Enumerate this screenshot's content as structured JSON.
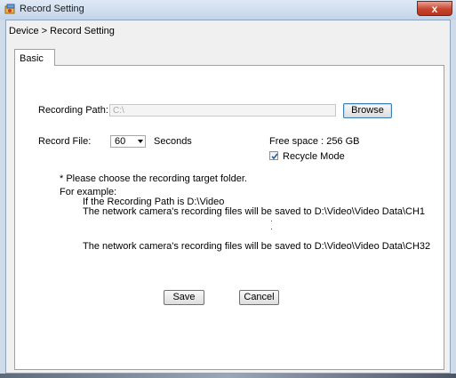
{
  "window": {
    "title": "Record Setting",
    "close_glyph": "x"
  },
  "breadcrumb": "Device > Record Setting",
  "tabs": [
    {
      "label": "Basic"
    }
  ],
  "form": {
    "recording_path_label": "Recording Path:",
    "recording_path_value": "C:\\",
    "browse_label": "Browse",
    "record_file_label": "Record File:",
    "record_file_value": "60",
    "record_file_unit": "Seconds",
    "free_space": "Free space : 256 GB",
    "recycle_mode_label": "Recycle Mode",
    "recycle_mode_checked": true
  },
  "info": {
    "note": "* Please choose the recording target folder.",
    "example_heading": "For example:",
    "example_line1": "If the Recording Path is D:\\Video",
    "example_line2": "The network camera's recording files will be saved to D:\\Video\\Video Data\\CH1",
    "example_line3": "The network camera's recording files will be saved to D:\\Video\\Video Data\\CH32"
  },
  "buttons": {
    "save": "Save",
    "cancel": "Cancel"
  },
  "colors": {
    "close_button": "#c6452f",
    "titlebar": "#c3d4e8",
    "browse_border": "#3c7fb1"
  },
  "icons": {
    "app": "record-setting-app-icon",
    "close": "close-icon",
    "dropdown": "chevron-down-icon",
    "check": "checkmark-icon"
  }
}
